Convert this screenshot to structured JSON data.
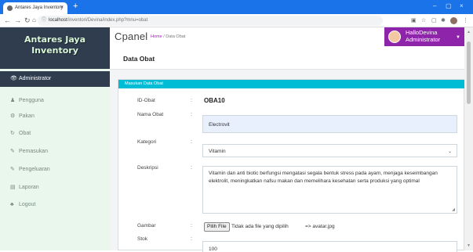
{
  "browser": {
    "tab_title": "Antares Jaya Inventory",
    "tab_close": "×",
    "new_tab": "+",
    "url_host": "localhost",
    "url_path": "/inventori/Devina/index.php?mnu=obat",
    "win_min": "–",
    "win_max": "▢",
    "win_close": "×"
  },
  "sidebar": {
    "brand_line1": "Antares Jaya",
    "brand_line2": "Inventory",
    "items": [
      {
        "label": "Administrator",
        "icon": "eye-icon",
        "glyph": "👁"
      },
      {
        "label": "Pengguna",
        "icon": "user-icon",
        "glyph": "♟"
      },
      {
        "label": "Pakan",
        "icon": "gear-icon",
        "glyph": "⚙"
      },
      {
        "label": "Obat",
        "icon": "refresh-icon",
        "glyph": "↻"
      },
      {
        "label": "Pemasukan",
        "icon": "pencil-icon",
        "glyph": "✎"
      },
      {
        "label": "Pengeluaran",
        "icon": "pencil-icon",
        "glyph": "✎"
      },
      {
        "label": "Laporan",
        "icon": "layers-icon",
        "glyph": "▤"
      },
      {
        "label": "Logout",
        "icon": "users-icon",
        "glyph": "♣"
      }
    ]
  },
  "header": {
    "title": "Cpanel",
    "breadcrumb_home": "Home",
    "breadcrumb_sep": "/",
    "breadcrumb_current": "Data Obat",
    "user_greeting": "HalloDevina",
    "user_role": "Administrator"
  },
  "main": {
    "page_title": "Data Obat",
    "card_title": "Masukan Data Obat",
    "form": {
      "id_label": "ID-Obat",
      "id_value": "OBA10",
      "nama_label": "Nama Obat",
      "nama_value": "Electrovit",
      "kategori_label": "Kategori",
      "kategori_value": "Vitamin",
      "deskripsi_label": "Deskripsi",
      "deskripsi_value": "Vitamin dan anti biotic berfungsi mengatasi segala bentuk stress pada ayam, menjaga keseimbangan elektrolit, meningkatkan nafsu makan dan memelihara kesehatan serta produksi yang optimal",
      "gambar_label": "Gambar",
      "file_button": "Pilih File",
      "file_status": "Tidak ada file yang dipilih",
      "file_current": "=> avatar.jpg",
      "stok_label": "Stok",
      "stok_value": "100",
      "colon": ":"
    }
  },
  "colors": {
    "sidebar_dark": "#2f3d4e",
    "sidebar_bg": "#e9f7ec",
    "user_button": "#8e24aa",
    "card_header": "#00bcd4",
    "chrome": "#1a73e8"
  }
}
